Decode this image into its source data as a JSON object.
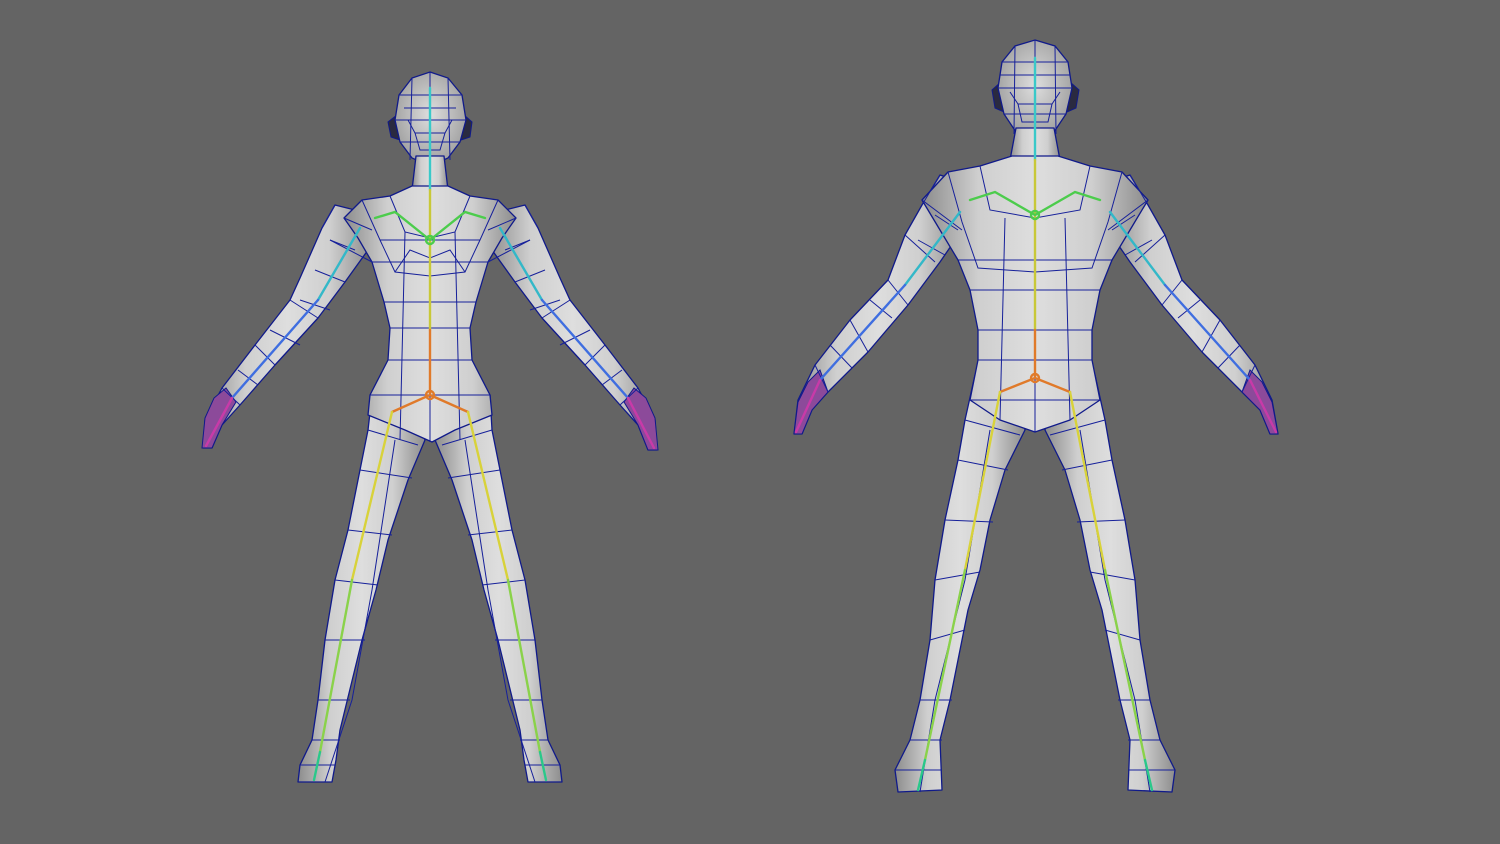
{
  "viewport": {
    "background": "#646464",
    "mesh_color": "#d2d2d2",
    "wireframe_color": "#16209a"
  },
  "models": [
    {
      "id": "character-female",
      "kind": "low-poly rigged mesh",
      "pose": "A-pose"
    },
    {
      "id": "character-male",
      "kind": "low-poly rigged mesh",
      "pose": "A-pose"
    }
  ],
  "joint_colors": {
    "spine": "#c8c838",
    "neck": "#39c9c9",
    "clavicle": "#4ccc4c",
    "arm_upper": "#33b8c8",
    "arm_lower": "#3f6ee0",
    "hand": "#b03ac8",
    "pelvis": "#e07a2a",
    "leg_upper": "#d8d23a",
    "leg_lower": "#8ad24a",
    "foot": "#2ac88a"
  }
}
